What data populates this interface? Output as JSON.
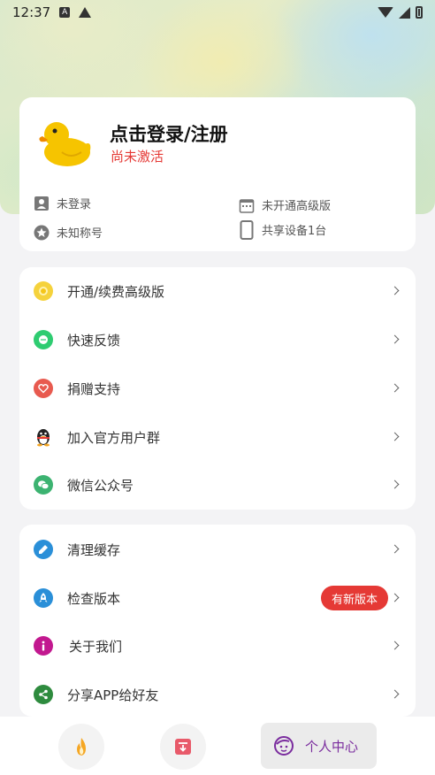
{
  "status_bar": {
    "time": "12:37"
  },
  "profile": {
    "login_title": "点击登录/注册",
    "activation_status": "尚未激活",
    "info": {
      "login_status": "未登录",
      "premium_status": "未开通高级版",
      "nickname": "未知称号",
      "shared_devices": "共享设备1台"
    }
  },
  "menu_group_1": [
    {
      "label": "开通/续费高级版",
      "icon": "premium-icon",
      "color": "#f5c518"
    },
    {
      "label": "快速反馈",
      "icon": "feedback-icon",
      "color": "#2ecc71"
    },
    {
      "label": "捐赠支持",
      "icon": "donate-heart-icon",
      "color": "#e85a4f"
    },
    {
      "label": "加入官方用户群",
      "icon": "qq-penguin-icon",
      "color": "#222222"
    },
    {
      "label": "微信公众号",
      "icon": "wechat-icon",
      "color": "#3cb371"
    }
  ],
  "menu_group_2": [
    {
      "label": "清理缓存",
      "icon": "broom-icon",
      "color": "#2a8fd8"
    },
    {
      "label": "检查版本",
      "icon": "rocket-icon",
      "color": "#2a8fd8",
      "badge": "有新版本"
    },
    {
      "label": "关于我们",
      "icon": "info-icon",
      "color": "#c2188f"
    },
    {
      "label": "分享APP给好友",
      "icon": "share-icon",
      "color": "#2e8b3e"
    }
  ],
  "bottom_nav": {
    "active_label": "个人中心"
  },
  "colors": {
    "accent_red": "#e53935",
    "active_purple": "#7a2c9e"
  }
}
